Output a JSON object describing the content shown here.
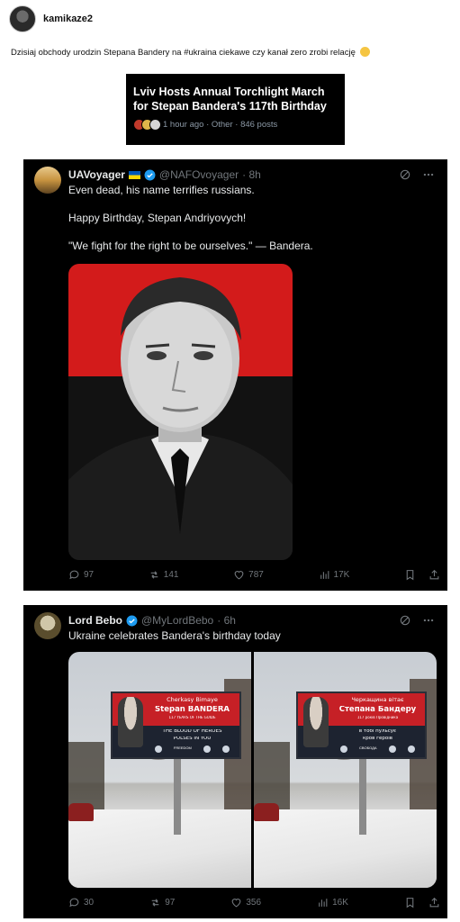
{
  "post": {
    "username": "kamikaze2",
    "text": "Dzisiaj obchody urodzin Stepana Bandery na #ukraina ciekawe czy kanał zero zrobi relację"
  },
  "trend": {
    "title": "Lviv Hosts Annual Torchlight March for Stepan Bandera's 117th Birthday",
    "meta": "1 hour ago · Other · 846 posts"
  },
  "tweets": [
    {
      "name": "UAVoyager",
      "handle": "@NAFOvoyager",
      "time": "· 8h",
      "lines": [
        "Even dead, his name terrifies russians.",
        "Happy Birthday, Stepan Andriyovych!",
        "\"We fight for the right to be ourselves.\" — Bandera."
      ],
      "stats": {
        "replies": "97",
        "reposts": "141",
        "likes": "787",
        "views": "17K"
      }
    },
    {
      "name": "Lord Bebo",
      "handle": "@MyLordBebo",
      "time": "· 6h",
      "lines": [
        "Ukraine celebrates Bandera's birthday today"
      ],
      "stats": {
        "replies": "30",
        "reposts": "97",
        "likes": "356",
        "views": "16K"
      },
      "billboards": [
        {
          "name_small": "Cherkasy Bimaye",
          "name_big": "Stepan BANDERA",
          "years": "117 YEARS OF THE GUIDE",
          "slogan1": "THE BLOOD OF HEROES",
          "slogan2": "PULSES IN YOU",
          "logo_text": "FREEDOM"
        },
        {
          "name_small": "Черкащина вітає",
          "name_big": "Степана Бандеру",
          "years": "117 років Провідника",
          "slogan1": "в тобі пульсує",
          "slogan2": "кров героїв",
          "logo_text": "СВОБОДА"
        }
      ]
    }
  ],
  "colors": {
    "tweet_bg": "#000000",
    "muted": "#71767b",
    "verified": "#1d9bf0",
    "flag_red": "#d31b1b"
  }
}
